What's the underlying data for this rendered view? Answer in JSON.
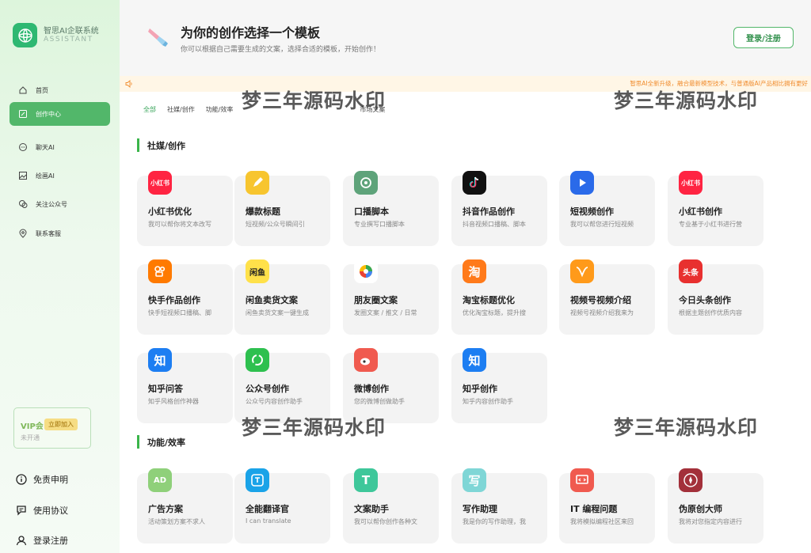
{
  "sidebar": {
    "brand": "智思AI企联系统",
    "brand_sub": "ASSISTANT",
    "items": [
      {
        "label": "首页",
        "icon": "home-icon"
      },
      {
        "label": "创作中心",
        "icon": "edit-icon"
      },
      {
        "label": "聊天AI",
        "icon": "chat-icon"
      },
      {
        "label": "绘画AI",
        "icon": "image-icon"
      },
      {
        "label": "关注公众号",
        "icon": "wechat-icon"
      },
      {
        "label": "联系客服",
        "icon": "location-icon"
      }
    ],
    "vip": {
      "title": "VIP会",
      "button": "立即加入",
      "status": "未开通"
    },
    "bottom": [
      {
        "label": "免责申明",
        "icon": "info-icon"
      },
      {
        "label": "使用协议",
        "icon": "agreement-icon"
      },
      {
        "label": "登录注册",
        "icon": "user-icon"
      }
    ]
  },
  "header": {
    "title": "为你的创作选择一个模板",
    "subtitle": "你可以根据自己需要生成的文案，选择合适的模板，开始创作！",
    "login": "登录/注册"
  },
  "notice": {
    "text": "智思AI全新升级，融合最新模型技术，与普通版AI产品相比拥有更好"
  },
  "tabs": [
    "全部",
    "社媒/创作",
    "功能/效率",
    "",
    "",
    "市场文案"
  ],
  "watermark": "梦三年源码水印",
  "sections": [
    {
      "title": "社媒/创作",
      "cards": [
        {
          "title": "小红书优化",
          "desc": "我可以帮你将文本改写",
          "icon": "xiaohongshu-icon",
          "color": "#ff2442",
          "glyph": "小红书"
        },
        {
          "title": "爆款标题",
          "desc": "短视频/公众号瞬间引",
          "icon": "pen-icon",
          "color": "#f7c52f",
          "glyph": ""
        },
        {
          "title": "口播脚本",
          "desc": "专业撰写口播脚本",
          "icon": "target-icon",
          "color": "#5ea37a",
          "glyph": ""
        },
        {
          "title": "抖音作品创作",
          "desc": "抖音视频口播稿、脚本",
          "icon": "douyin-icon",
          "color": "#111111",
          "glyph": ""
        },
        {
          "title": "短视频创作",
          "desc": "我可以帮您进行短视频",
          "icon": "play-icon",
          "color": "#2a6ae9",
          "glyph": ""
        },
        {
          "title": "小红书创作",
          "desc": "专业基于小红书进行营",
          "icon": "xiaohongshu-icon",
          "color": "#ff2442",
          "glyph": "小红书"
        },
        {
          "title": "快手作品创作",
          "desc": "快手短视频口播稿、脚",
          "icon": "kuaishou-icon",
          "color": "#ff7a00",
          "glyph": ""
        },
        {
          "title": "闲鱼卖货文案",
          "desc": "闲鱼卖货文案一键生成",
          "icon": "xianyu-icon",
          "color": "#ffe14a",
          "glyph": "闲鱼"
        },
        {
          "title": "朋友圈文案",
          "desc": "发圈文案 / 推文 / 日常",
          "icon": "moments-icon",
          "color": "#ffffff",
          "glyph": ""
        },
        {
          "title": "淘宝标题优化",
          "desc": "优化淘宝标题，提升搜",
          "icon": "taobao-icon",
          "color": "#ff7a1a",
          "glyph": "淘"
        },
        {
          "title": "视频号视频介绍",
          "desc": "视频号视频介绍我来为",
          "icon": "channels-icon",
          "color": "#ff9a1a",
          "glyph": ""
        },
        {
          "title": "今日头条创作",
          "desc": "根据主题创作优质内容",
          "icon": "toutiao-icon",
          "color": "#e8302f",
          "glyph": "头条"
        },
        {
          "title": "知乎问答",
          "desc": "知乎风格创作神器",
          "icon": "zhihu-icon",
          "color": "#1d7ef2",
          "glyph": "知"
        },
        {
          "title": "公众号创作",
          "desc": "公众号内容创作助手",
          "icon": "wechat-official-icon",
          "color": "#2ec04f",
          "glyph": ""
        },
        {
          "title": "微博创作",
          "desc": "您的微博创做助手",
          "icon": "weibo-icon",
          "color": "#f05a4f",
          "glyph": ""
        },
        {
          "title": "知乎创作",
          "desc": "知乎内容创作助手",
          "icon": "zhihu-icon",
          "color": "#1d7ef2",
          "glyph": "知"
        }
      ]
    },
    {
      "title": "功能/效率",
      "cards": [
        {
          "title": "广告方案",
          "desc": "活动策划方案不求人",
          "icon": "ad-icon",
          "color": "#8fd07a",
          "glyph": "AD"
        },
        {
          "title": "全能翻译官",
          "desc": "I can translate",
          "icon": "translate-icon",
          "color": "#1aa3e8",
          "glyph": ""
        },
        {
          "title": "文案助手",
          "desc": "我可以帮你创作各种文",
          "icon": "text-icon",
          "color": "#3ec79a",
          "glyph": "T"
        },
        {
          "title": "写作助理",
          "desc": "我是你的写作助理，我",
          "icon": "write-icon",
          "color": "#7fd6d6",
          "glyph": "写"
        },
        {
          "title": "IT 编程问题",
          "desc": "我将模拟编程社区来回",
          "icon": "code-icon",
          "color": "#f05a4f",
          "glyph": ""
        },
        {
          "title": "伪原创大师",
          "desc": "我将对您指定内容进行",
          "icon": "master-icon",
          "color": "#a3303a",
          "glyph": ""
        }
      ]
    }
  ]
}
